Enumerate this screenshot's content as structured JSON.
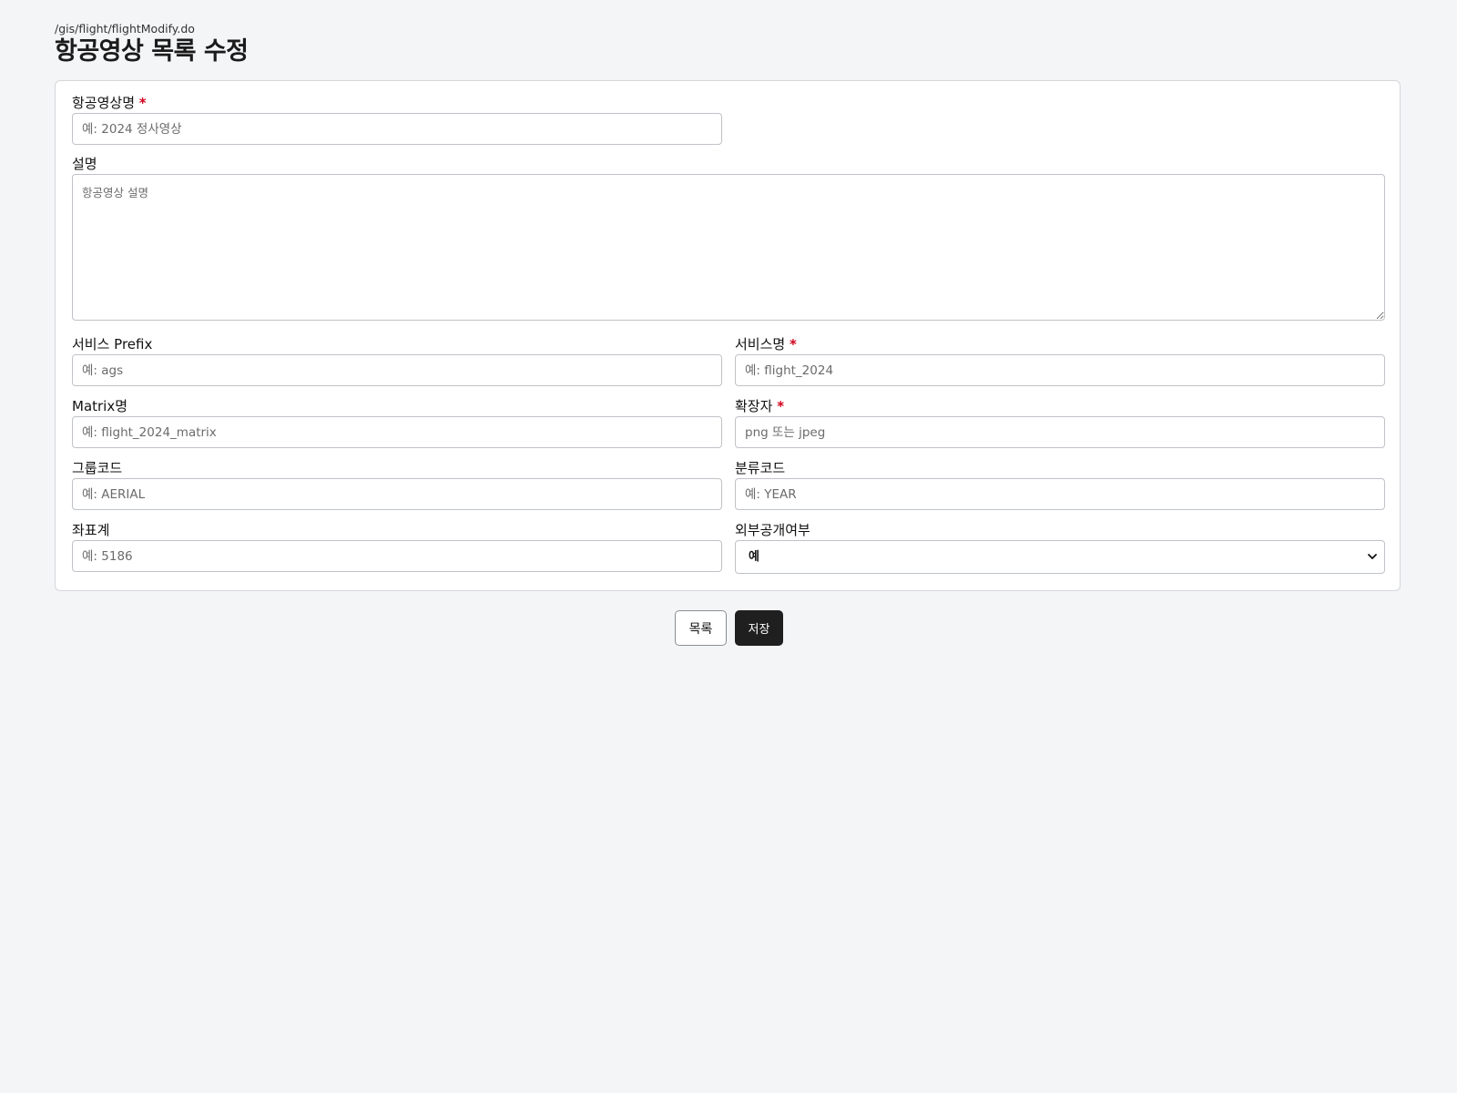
{
  "header": {
    "path": "/gis/flight/flightModify.do",
    "title": "항공영상 목록 수정"
  },
  "form": {
    "name": {
      "label": "항공영상명",
      "required_mark": "*",
      "value": "",
      "placeholder": "예: 2024 정사영상"
    },
    "description": {
      "label": "설명",
      "value": "",
      "placeholder": "항공영상 설명"
    },
    "service_prefix": {
      "label": "서비스 Prefix",
      "value": "",
      "placeholder": "예: ags"
    },
    "service_name": {
      "label": "서비스명",
      "required_mark": "*",
      "value": "",
      "placeholder": "예: flight_2024"
    },
    "matrix_name": {
      "label": "Matrix명",
      "value": "",
      "placeholder": "예: flight_2024_matrix"
    },
    "extension": {
      "label": "확장자",
      "required_mark": "*",
      "value": "",
      "placeholder": "png 또는 jpeg"
    },
    "group_code": {
      "label": "그룹코드",
      "value": "",
      "placeholder": "예: AERIAL"
    },
    "class_code": {
      "label": "분류코드",
      "value": "",
      "placeholder": "예: YEAR"
    },
    "coord_system": {
      "label": "좌표계",
      "value": "",
      "placeholder": "예: 5186"
    },
    "public_flag": {
      "label": "외부공개여부",
      "selected": "예",
      "icon": "chevron-down-icon"
    }
  },
  "actions": {
    "list_label": "목록",
    "save_label": "저장"
  }
}
